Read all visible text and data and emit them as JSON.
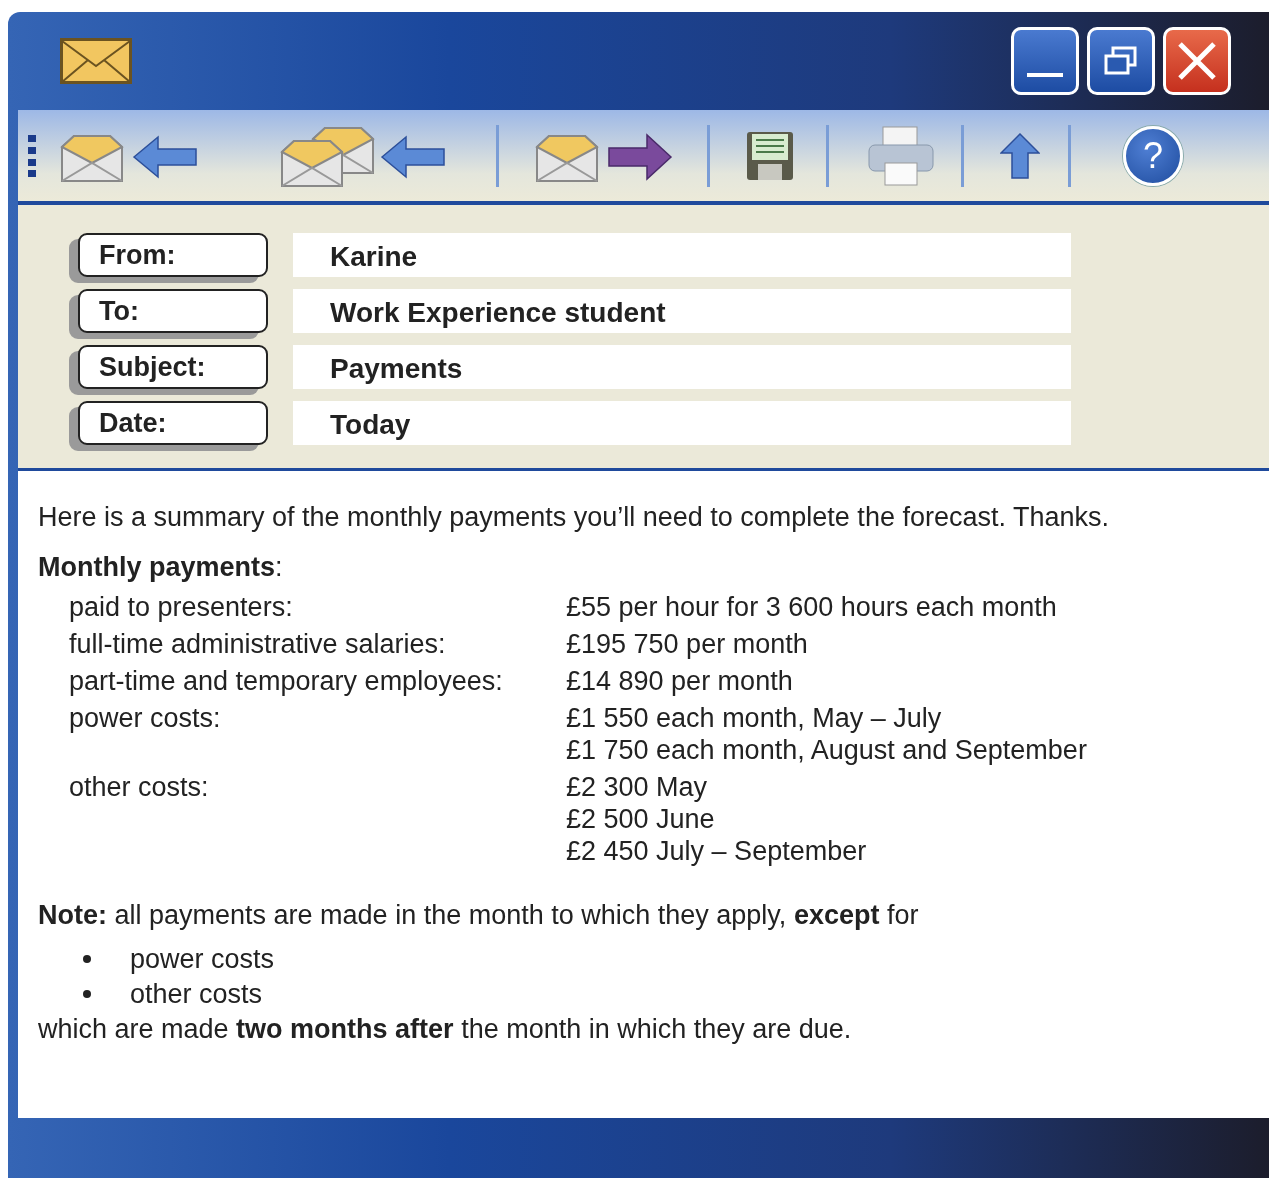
{
  "toolbar": {
    "help_label": "?"
  },
  "header_fields": [
    {
      "label": "From:",
      "value": "Karine"
    },
    {
      "label": "To:",
      "value": "Work Experience student"
    },
    {
      "label": "Subject:",
      "value": "Payments"
    },
    {
      "label": "Date:",
      "value": "Today"
    }
  ],
  "message": {
    "intro": "Here is a summary of the monthly payments you’ll need to complete the forecast. Thanks.",
    "heading": "**Monthly payments**:",
    "payments": [
      {
        "label": "paid to presenters:",
        "amounts": [
          "£55 per hour for 3 600 hours each month"
        ]
      },
      {
        "label": "full-time administrative salaries:",
        "amounts": [
          "£195 750 per month"
        ]
      },
      {
        "label": "part-time and temporary employees:",
        "amounts": [
          "£14 890 per month"
        ]
      },
      {
        "label": "power costs:",
        "amounts": [
          "£1 550 each month, May – July",
          "£1 750 each month, August and September"
        ]
      },
      {
        "label": "other costs:",
        "amounts": [
          "£2 300 May",
          "£2 500 June",
          "£2 450 July – September"
        ]
      }
    ],
    "note": "**Note:** all payments are made in the month to which they apply, **except** for",
    "bullets": [
      "power costs",
      "other costs"
    ],
    "closing": "which are made **two months after** the month in which they are due."
  }
}
